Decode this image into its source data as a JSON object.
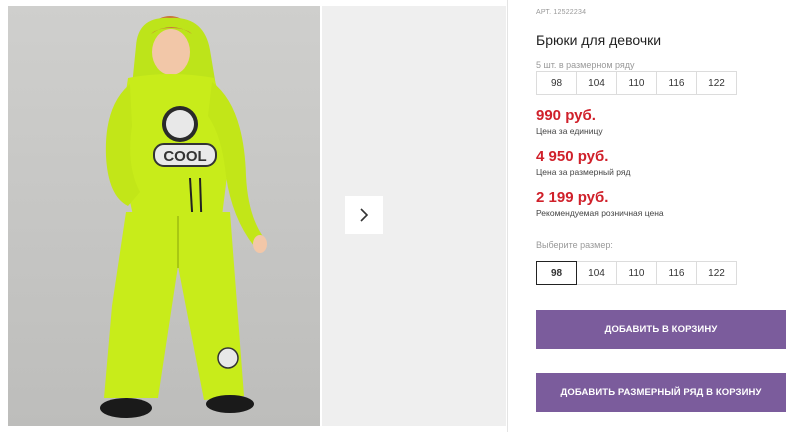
{
  "gallery": {
    "main_image_alt": "",
    "next_icon": "chevron-right-icon"
  },
  "product": {
    "sku": "АРТ. 12522234",
    "title": "Брюки для девочки",
    "pack_info": "5 шт. в размерном ряду",
    "pack_sizes": [
      "98",
      "104",
      "110",
      "116",
      "122"
    ],
    "prices": [
      {
        "value": "990 руб.",
        "caption": "Цена за единицу"
      },
      {
        "value": "4 950 руб.",
        "caption": "Цена за размерный ряд"
      },
      {
        "value": "2 199 руб.",
        "caption": "Рекомендуемая розничная цена"
      }
    ],
    "choose_size_label": "Выберите размер:",
    "size_options": [
      "98",
      "104",
      "110",
      "116",
      "122"
    ],
    "selected_size": "98",
    "add_to_cart_label": "ДОБАВИТЬ В КОРЗИНУ",
    "add_pack_to_cart_label": "ДОБАВИТЬ РАЗМЕРНЫЙ РЯД В КОРЗИНУ"
  },
  "colors": {
    "price": "#d0202a",
    "button": "#7b5c9c",
    "outfit": "#c8ec1a",
    "background_photo": "#c9c9c7"
  }
}
